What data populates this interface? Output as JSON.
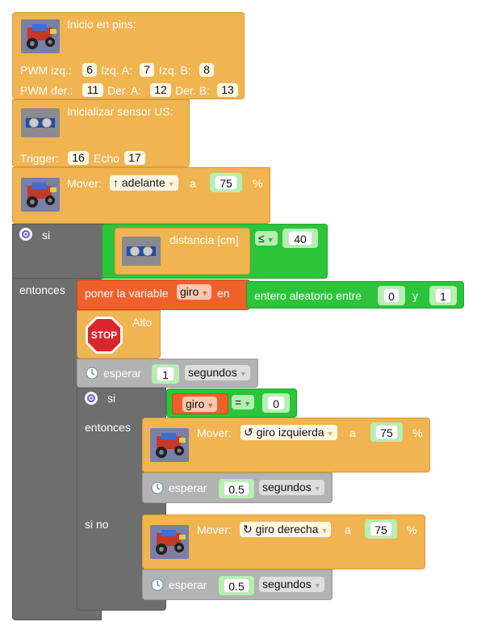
{
  "init_pins": {
    "title": "Inicio en pins:",
    "pwm_left_label": "PWM izq.:",
    "pwm_left": "6",
    "left_a_label": "Izq. A:",
    "left_a": "7",
    "left_b_label": "Izq. B:",
    "left_b": "8",
    "pwm_right_label": "PWM der.:",
    "pwm_right": "11",
    "right_a_label": "Der. A:",
    "right_a": "12",
    "right_b_label": "Der. B:",
    "right_b": "13"
  },
  "us_init": {
    "title": "Inicializar sensor US:",
    "trigger_label": "Trigger:",
    "trigger": "16",
    "echo_label": "Echo",
    "echo": "17"
  },
  "move1": {
    "label": "Mover:",
    "dir": "↑ adelante",
    "a": "a",
    "speed": "75",
    "unit": "%"
  },
  "if1": {
    "si": "si",
    "entonces": "entonces",
    "distance_label": "distancia [cm]",
    "op": "≤",
    "value": "40"
  },
  "set_var": {
    "label": "poner la variable",
    "var": "giro",
    "en": "en",
    "random_label": "entero aleatorio entre",
    "min": "0",
    "y": "y",
    "max": "1"
  },
  "stop": {
    "label": "Alto",
    "sign": "STOP"
  },
  "wait1": {
    "label": "esperar",
    "value": "1",
    "unit": "segundos"
  },
  "if2": {
    "si": "si",
    "entonces": "entonces",
    "sino": "si no",
    "var": "giro",
    "op": "=",
    "value": "0"
  },
  "move_left": {
    "label": "Mover:",
    "dir": "↺ giro izquierda",
    "a": "a",
    "speed": "75",
    "unit": "%"
  },
  "wait2": {
    "label": "esperar",
    "value": "0.5",
    "unit": "segundos"
  },
  "move_right": {
    "label": "Mover:",
    "dir": "↻ giro derecha",
    "a": "a",
    "speed": "75",
    "unit": "%"
  },
  "wait3": {
    "label": "esperar",
    "value": "0.5",
    "unit": "segundos"
  },
  "colors": {
    "motor_block": "#f0b451",
    "control_block": "#6e6e6e",
    "logic_block": "#2bc43b",
    "variable_block": "#f0602c",
    "wait_block": "#b3b3b3"
  }
}
